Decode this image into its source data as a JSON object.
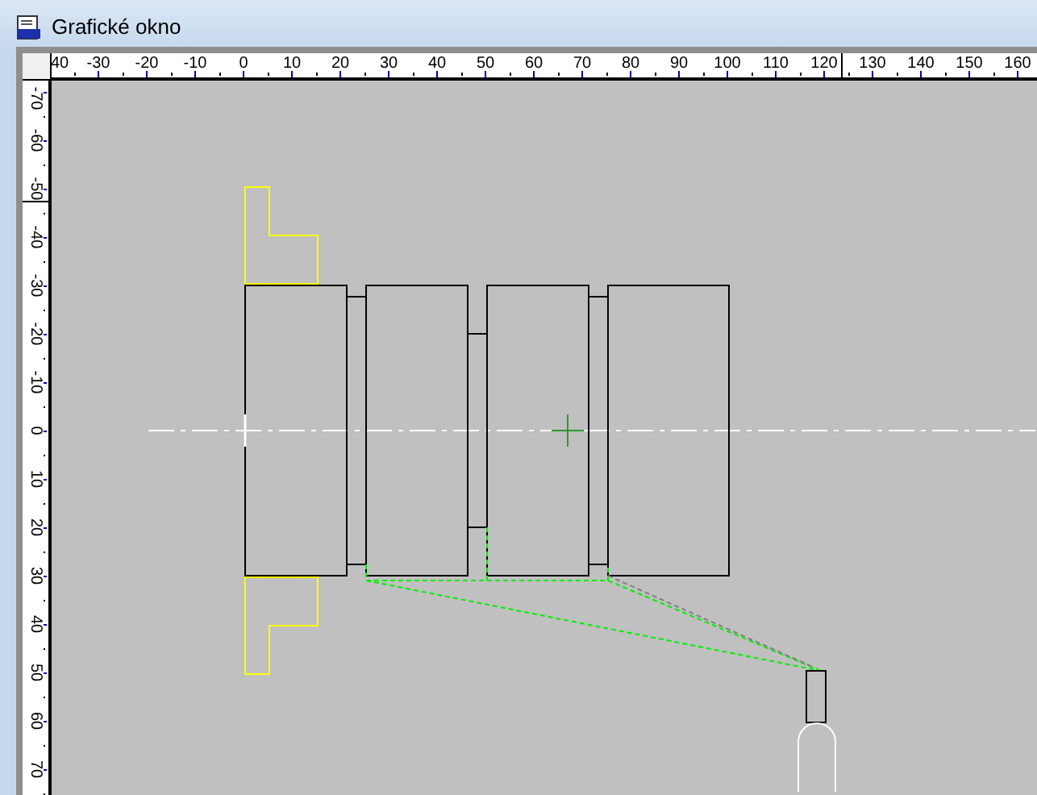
{
  "window": {
    "title": "Grafické okno"
  },
  "rulers": {
    "horizontal": [
      "40",
      "-30",
      "-20",
      "-10",
      "0",
      "10",
      "20",
      "30",
      "40",
      "50",
      "60",
      "70",
      "80",
      "90",
      "100",
      "110",
      "120",
      "130",
      "140",
      "150",
      "160"
    ],
    "vertical": [
      "-70",
      "-60",
      "-50",
      "-40",
      "-30",
      "-20",
      "-10",
      "0",
      "10",
      "20",
      "30",
      "40",
      "50",
      "60",
      "70"
    ]
  }
}
